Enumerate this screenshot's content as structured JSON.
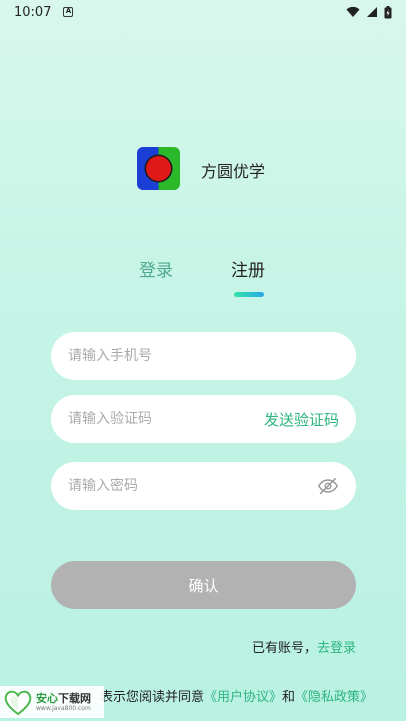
{
  "status_bar": {
    "time": "10:07"
  },
  "app": {
    "name": "方圆优学"
  },
  "tabs": [
    {
      "label": "登录"
    },
    {
      "label": "注册"
    }
  ],
  "form": {
    "phone_placeholder": "请输入手机号",
    "code_placeholder": "请输入验证码",
    "send_code_label": "发送验证码",
    "password_placeholder": "请输入密码",
    "confirm_label": "确认"
  },
  "footer": {
    "have_account_text": "已有账号，",
    "go_login_label": "去登录",
    "agreement_prefix": "表示您阅读并同意",
    "user_agreement": "《用户协议》",
    "and": "和",
    "privacy_policy": "《隐私政策》"
  },
  "watermark": {
    "title_green": "安心",
    "title_dark": "下载网",
    "url": "www.java800.com"
  },
  "colors": {
    "accent": "#2db57f",
    "tab_inactive": "#4fa88e",
    "button_disabled": "#b2b2b2"
  }
}
